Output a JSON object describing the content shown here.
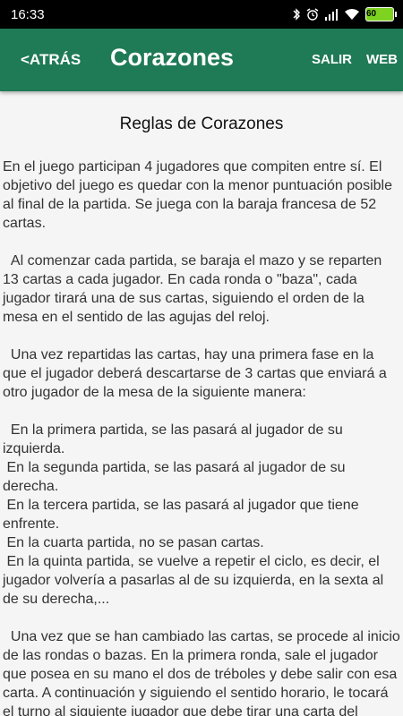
{
  "status_bar": {
    "time": "16:33",
    "icons": [
      "bluetooth-icon",
      "alarm-icon",
      "signal-icon",
      "wifi-icon",
      "battery-icon"
    ],
    "battery": "60"
  },
  "app_bar": {
    "back_label": "<ATRÁS",
    "title": "Corazones",
    "salir_label": "SALIR",
    "web_label": "WEB",
    "color": "#1f7a56"
  },
  "content": {
    "heading": "Reglas de Corazones",
    "paragraphs": [
      "En el juego participan 4 jugadores que compiten entre sí. El objetivo del juego es quedar con la menor puntuación posible al final de la partida. Se juega con la baraja francesa de 52 cartas.",
      "  Al comenzar cada partida, se baraja el mazo y se reparten 13 cartas a cada jugador. En cada ronda o \"baza\", cada jugador tirará una de sus cartas, siguiendo el orden de la mesa en el sentido de las agujas del reloj.",
      "  Una vez repartidas las cartas, hay una primera fase en la que el jugador deberá descartarse de 3 cartas que enviará a otro jugador de la mesa de la siguiente manera:",
      "  En la primera partida, se las pasará al jugador de su izquierda.\n En la segunda partida, se las pasará al jugador de su derecha.\n En la tercera partida, se las pasará al jugador que tiene enfrente.\n En la cuarta partida, no se pasan cartas.\n En la quinta partida, se vuelve a repetir el ciclo, es decir, el jugador volvería a pasarlas al de su izquierda, en la sexta al de su derecha,...",
      "  Una vez que se han cambiado las cartas, se procede al inicio de las rondas o bazas. En la primera ronda, sale el jugador que posea en su mano el dos de tréboles y debe salir con esa carta. A continuación y siguiendo el sentido horario, le tocará el turno al siguiente jugador que debe tirar una carta del mismo palo. Si no tiene"
    ]
  }
}
